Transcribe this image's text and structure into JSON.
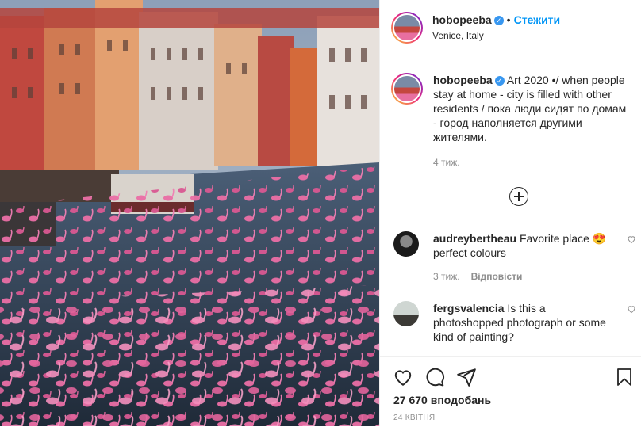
{
  "post": {
    "username": "hobopeeba",
    "verified_badge": "✓",
    "separator": "•",
    "follow_label": "Стежити",
    "location": "Venice, Italy",
    "caption": "Art 2020 •/ when people stay at home - city is filled with other residents / пока люди сидят по домам - город наполняется другими жителями.",
    "caption_time": "4 тиж.",
    "likes": "27 670 вподобань",
    "date": "24 КВІТНЯ"
  },
  "comments": [
    {
      "username": "audreybertheau",
      "text": "Favorite place 😍 perfect colours",
      "time": "3 тиж.",
      "reply_label": "Відповісти"
    },
    {
      "username": "fergsvalencia",
      "text": "Is this a photoshopped photograph or some kind of painting?"
    }
  ],
  "colors": {
    "accent": "#0095f6",
    "verified": "#3897f0",
    "flamingo": "#e86fa0",
    "water": "#2f3f52"
  },
  "icons": [
    "verified-icon",
    "add-comment-icon",
    "heart-icon",
    "comment-icon",
    "share-icon",
    "bookmark-icon"
  ]
}
